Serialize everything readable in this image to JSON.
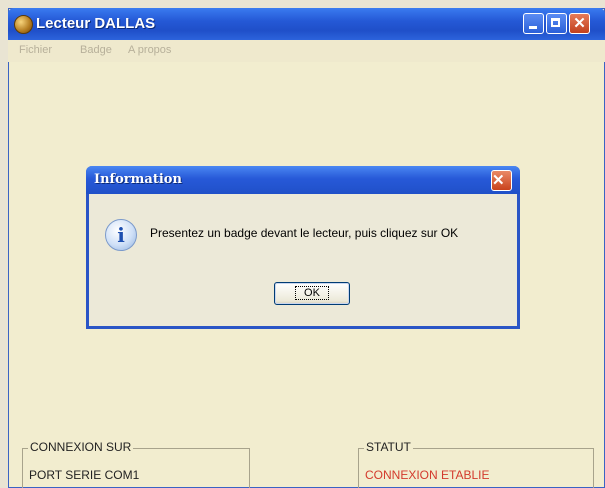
{
  "window": {
    "title": "Lecteur DALLAS",
    "icon": "app-coin-icon"
  },
  "menu": {
    "items": [
      {
        "label": "Fichier"
      },
      {
        "label": "Badge"
      },
      {
        "label": "A propos"
      }
    ]
  },
  "dialog": {
    "title": "Information",
    "icon": "info-icon",
    "message": "Presentez un badge devant le lecteur, puis cliquez sur OK",
    "ok_label": "OK"
  },
  "connexion": {
    "legend": "CONNEXION SUR",
    "value": "PORT SERIE COM1"
  },
  "statut": {
    "legend": "STATUT",
    "value": "CONNEXION ETABLIE",
    "value_color": "#d33a2c"
  },
  "colors": {
    "titlebar": "#2559d6",
    "window_bg": "#f2edcf",
    "dialog_bg": "#ece9d8"
  }
}
